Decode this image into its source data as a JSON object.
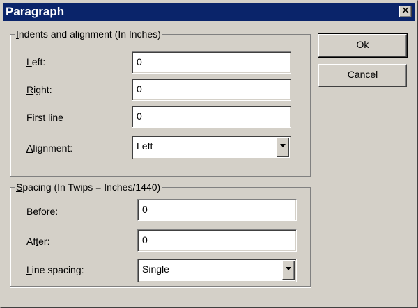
{
  "window": {
    "title": "Paragraph",
    "close_glyph": "✕"
  },
  "indents": {
    "legend_pre": "",
    "legend_key": "I",
    "legend_post": "ndents and alignment (In Inches)",
    "left": {
      "pre": "",
      "key": "L",
      "post": "eft:",
      "value": "0"
    },
    "right": {
      "pre": "",
      "key": "R",
      "post": "ight:",
      "value": "0"
    },
    "first_line": {
      "pre": "Fir",
      "key": "s",
      "post": "t line",
      "value": "0"
    },
    "alignment": {
      "pre": "",
      "key": "A",
      "post": "lignment:",
      "value": "Left"
    }
  },
  "spacing": {
    "legend_pre": "",
    "legend_key": "S",
    "legend_post": "pacing (In Twips = Inches/1440)",
    "before": {
      "pre": "",
      "key": "B",
      "post": "efore:",
      "value": "0"
    },
    "after": {
      "pre": "Af",
      "key": "t",
      "post": "er:",
      "value": "0"
    },
    "line_spacing": {
      "pre": "",
      "key": "L",
      "post": "ine spacing:",
      "value": "Single"
    }
  },
  "buttons": {
    "ok": "Ok",
    "cancel": "Cancel"
  },
  "icons": {
    "close": "close-icon",
    "dropdown": "chevron-down-icon"
  }
}
